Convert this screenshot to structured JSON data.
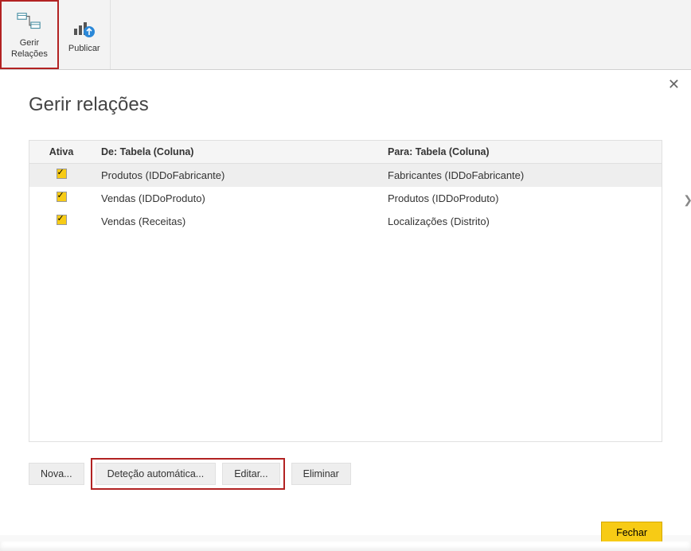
{
  "ribbon": {
    "manage_relations": {
      "label": "Gerir\nRelações"
    },
    "publish": {
      "label": "Publicar"
    }
  },
  "dialog": {
    "title": "Gerir relações",
    "columns": {
      "active": "Ativa",
      "from": "De: Tabela (Coluna)",
      "to": "Para: Tabela (Coluna)"
    },
    "rows": [
      {
        "active": true,
        "from": "Produtos (IDDoFabricante)",
        "to": "Fabricantes (IDDoFabricante)",
        "selected": true
      },
      {
        "active": true,
        "from": "Vendas (IDDoProduto)",
        "to": "Produtos (IDDoProduto)",
        "selected": false
      },
      {
        "active": true,
        "from": "Vendas (Receitas)",
        "to": "Localizações (Distrito)",
        "selected": false
      }
    ],
    "buttons": {
      "new": "Nova...",
      "autodetect": "Deteção automática...",
      "edit": "Editar...",
      "delete": "Eliminar",
      "close": "Fechar"
    }
  }
}
